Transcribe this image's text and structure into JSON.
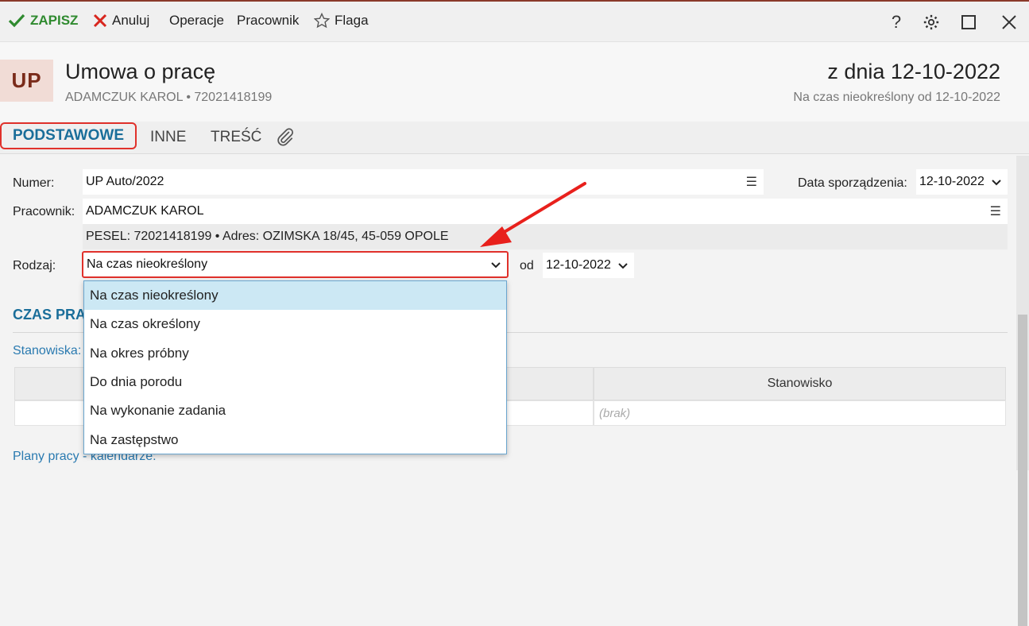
{
  "toolbar": {
    "save": "ZAPISZ",
    "cancel": "Anuluj",
    "operations": "Operacje",
    "employee": "Pracownik",
    "flag": "Flaga",
    "help": "?"
  },
  "header": {
    "badge": "UP",
    "title": "Umowa o pracę",
    "subtitle": "ADAMCZUK KAROL  •  72021418199",
    "date": "z dnia 12-10-2022",
    "period": "Na czas nieokreślony od 12-10-2022"
  },
  "tabs": [
    "PODSTAWOWE",
    "INNE",
    "TREŚĆ"
  ],
  "form": {
    "numer_label": "Numer:",
    "numer_value": "UP Auto/2022",
    "data_label": "Data sporządzenia:",
    "data_value": "12-10-2022",
    "pracownik_label": "Pracownik:",
    "pracownik_value": "ADAMCZUK KAROL",
    "info": "PESEL:  72021418199  •  Adres:  OZIMSKA 18/45, 45-059 OPOLE",
    "rodzaj_label": "Rodzaj:",
    "rodzaj_value": "Na czas nieokreślony",
    "od_label": "od",
    "od_value": "12-10-2022"
  },
  "section": {
    "title": "CZAS PRA",
    "stanowiska_label": "Stanowiska:",
    "column_stanowisko": "Stanowisko",
    "empty_value": "(brak)",
    "plany_label": "Plany pracy - kalendarze:"
  },
  "dropdown": {
    "options": [
      "Na czas nieokreślony",
      "Na czas określony",
      "Na okres próbny",
      "Do dnia porodu",
      "Na wykonanie zadania",
      "Na zastępstwo"
    ],
    "selected_index": 0
  },
  "colors": {
    "accent": "#1a6e9a",
    "highlight": "#e0312b",
    "save_green": "#2f8a2f",
    "badge_bg": "#f1dcd6"
  }
}
